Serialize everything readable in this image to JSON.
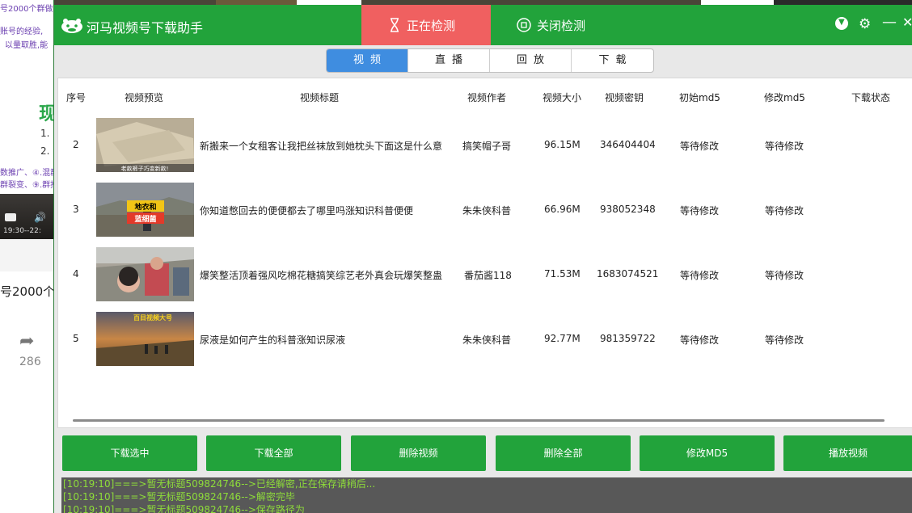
{
  "background": {
    "title": "号2000个群做号操作:",
    "line1": "账号的经验,",
    "line2": "以量取胜,能",
    "big_char": "现",
    "num1": "1.",
    "num2": "2.",
    "line3": "数推广、④.混群",
    "line4": "群裂变、⑨.群推",
    "video_time": "19:30--22:",
    "line5": "号2000个群",
    "share_count": "286"
  },
  "app": {
    "title": "河马视频号下载助手",
    "tab_detecting": "正在检测",
    "tab_close_detect": "关闭检测"
  },
  "segments": [
    "视频",
    "直播",
    "回放",
    "下载"
  ],
  "table": {
    "headers": [
      "序号",
      "视频预览",
      "视频标题",
      "视频作者",
      "视频大小",
      "视频密钥",
      "初始md5",
      "修改md5",
      "下载状态"
    ],
    "rows": [
      {
        "index": "2",
        "title": "新搬来一个女租客让我把丝袜放到她枕头下面这是什么意",
        "author": "搞笑帽子哥",
        "size": "96.15M",
        "key": "346404404",
        "md5_init": "等待修改",
        "md5_mod": "等待修改",
        "thumb_text": "老款裤子巧变新款!"
      },
      {
        "index": "3",
        "title": "你知道憋回去的便便都去了哪里吗涨知识科普便便",
        "author": "朱朱侠科普",
        "size": "66.96M",
        "key": "938052348",
        "md5_init": "等待修改",
        "md5_mod": "等待修改",
        "thumb_text": "地衣和蓝细菌"
      },
      {
        "index": "4",
        "title": "爆笑整活顶着强风吃棉花糖搞笑综艺老外真会玩爆笑整蛊",
        "author": "番茄酱118",
        "size": "71.53M",
        "key": "1683074521",
        "md5_init": "等待修改",
        "md5_mod": "等待修改",
        "thumb_text": ""
      },
      {
        "index": "5",
        "title": "尿液是如何产生的科普涨知识尿液",
        "author": "朱朱侠科普",
        "size": "92.77M",
        "key": "981359722",
        "md5_init": "等待修改",
        "md5_mod": "等待修改",
        "thumb_text": "百目视频大号"
      }
    ]
  },
  "buttons": [
    "下载选中",
    "下载全部",
    "删除视频",
    "删除全部",
    "修改MD5",
    "播放视频"
  ],
  "log": [
    "[10:19:10]===>暂无标题509824746-->已经解密,正在保存请稍后...",
    "[10:19:10]===>暂无标题509824746-->解密完毕",
    "[10:19:10]===>暂无标题509824746-->保存路径为"
  ],
  "colors": {
    "green": "#22a33b",
    "detect_tab": "#f06060",
    "segment_active": "#3f8de0",
    "log_text": "#8edc3a"
  }
}
